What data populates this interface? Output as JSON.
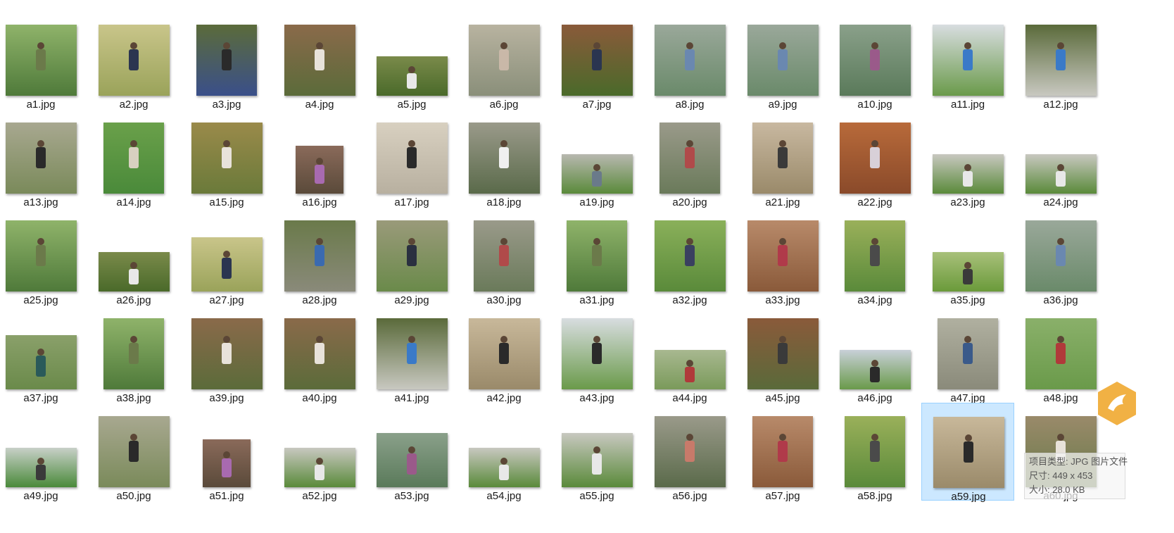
{
  "files": [
    {
      "name": "a1.jpg",
      "colors": [
        "#4f7a3a",
        "#8fb36a"
      ],
      "shape": "wide",
      "shirt": "#6b7a4a"
    },
    {
      "name": "a2.jpg",
      "colors": [
        "#9aa35a",
        "#c9c58a"
      ],
      "shape": "wide",
      "shirt": "#2b3550"
    },
    {
      "name": "a3.jpg",
      "colors": [
        "#3a4f8a",
        "#5b6b3a"
      ],
      "shape": "square",
      "shirt": "#2a2a2a"
    },
    {
      "name": "a4.jpg",
      "colors": [
        "#5b6b3a",
        "#8a6a4a"
      ],
      "shape": "wide",
      "shirt": "#e8e2da"
    },
    {
      "name": "a5.jpg",
      "colors": [
        "#4a6a2a",
        "#7a8a4a"
      ],
      "shape": "short",
      "shirt": "#e8e8e8"
    },
    {
      "name": "a6.jpg",
      "colors": [
        "#8a8f7a",
        "#b8b3a0"
      ],
      "shape": "wide",
      "shirt": "#c9b8a8"
    },
    {
      "name": "a7.jpg",
      "colors": [
        "#4a6a2a",
        "#8a5a3a"
      ],
      "shape": "wide",
      "shirt": "#2b3550"
    },
    {
      "name": "a8.jpg",
      "colors": [
        "#6a8a6a",
        "#9aa89a"
      ],
      "shape": "wide",
      "shirt": "#6a88b0"
    },
    {
      "name": "a9.jpg",
      "colors": [
        "#6a8a6a",
        "#9aa89a"
      ],
      "shape": "wide",
      "shirt": "#6a88b0"
    },
    {
      "name": "a10.jpg",
      "colors": [
        "#5a7a5a",
        "#8aa08a"
      ],
      "shape": "wide",
      "shirt": "#9a5a8a"
    },
    {
      "name": "a11.jpg",
      "colors": [
        "#6a9a4a",
        "#d8dde0"
      ],
      "shape": "wide",
      "shirt": "#3a7ac8"
    },
    {
      "name": "a12.jpg",
      "colors": [
        "#c8c8c0",
        "#5a6a3a"
      ],
      "shape": "wide",
      "shirt": "#3a7ac8"
    },
    {
      "name": "a13.jpg",
      "colors": [
        "#7a8a5a",
        "#a8a890"
      ],
      "shape": "wide",
      "shirt": "#2a2a2a"
    },
    {
      "name": "a14.jpg",
      "colors": [
        "#4a8a3a",
        "#6aa04a"
      ],
      "shape": "square",
      "shirt": "#d8d0c0"
    },
    {
      "name": "a15.jpg",
      "colors": [
        "#6a7a3a",
        "#9a8a4a"
      ],
      "shape": "wide",
      "shirt": "#e8e2da"
    },
    {
      "name": "a16.jpg",
      "colors": [
        "#5a4a3a",
        "#8a6a5a"
      ],
      "shape": "small",
      "shirt": "#a86ab0"
    },
    {
      "name": "a17.jpg",
      "colors": [
        "#b8b0a0",
        "#d8d0c0"
      ],
      "shape": "wide",
      "shirt": "#2a2a2a"
    },
    {
      "name": "a18.jpg",
      "colors": [
        "#5a6a4a",
        "#9a9a8a"
      ],
      "shape": "wide",
      "shirt": "#f0f0f0"
    },
    {
      "name": "a19.jpg",
      "colors": [
        "#5a8a3a",
        "#b8b8b0"
      ],
      "shape": "short",
      "shirt": "#6a7a8a"
    },
    {
      "name": "a20.jpg",
      "colors": [
        "#6a7a5a",
        "#9a9a8a"
      ],
      "shape": "square",
      "shirt": "#b04a4a"
    },
    {
      "name": "a21.jpg",
      "colors": [
        "#9a8a6a",
        "#c8b8a0"
      ],
      "shape": "square",
      "shirt": "#3a3a3a"
    },
    {
      "name": "a22.jpg",
      "colors": [
        "#8a4a2a",
        "#b86a3a"
      ],
      "shape": "wide",
      "shirt": "#d8d0d8"
    },
    {
      "name": "a23.jpg",
      "colors": [
        "#5a8a3a",
        "#c8c8c0"
      ],
      "shape": "short",
      "shirt": "#e8e8e8"
    },
    {
      "name": "a24.jpg",
      "colors": [
        "#5a8a3a",
        "#c8c8c0"
      ],
      "shape": "short",
      "shirt": "#e8e8e8"
    },
    {
      "name": "a25.jpg",
      "colors": [
        "#4f7a3a",
        "#8fb36a"
      ],
      "shape": "wide",
      "shirt": "#6b7a4a"
    },
    {
      "name": "a26.jpg",
      "colors": [
        "#4a6a2a",
        "#7a8a4a"
      ],
      "shape": "short",
      "shirt": "#e8e8e8"
    },
    {
      "name": "a27.jpg",
      "colors": [
        "#9aa35a",
        "#c9c58a"
      ],
      "shape": "short2",
      "shirt": "#2b3550"
    },
    {
      "name": "a28.jpg",
      "colors": [
        "#8a8a7a",
        "#6a7a4a"
      ],
      "shape": "wide",
      "shirt": "#3a6ab0"
    },
    {
      "name": "a29.jpg",
      "colors": [
        "#6a8a4a",
        "#9a9a7a"
      ],
      "shape": "wide",
      "shirt": "#2a3040"
    },
    {
      "name": "a30.jpg",
      "colors": [
        "#6a7a5a",
        "#9a9a8a"
      ],
      "shape": "square",
      "shirt": "#b04a4a"
    },
    {
      "name": "a31.jpg",
      "colors": [
        "#4f7a3a",
        "#8fb36a"
      ],
      "shape": "square",
      "shirt": "#6b7a4a"
    },
    {
      "name": "a32.jpg",
      "colors": [
        "#5a8a3a",
        "#8ab05a"
      ],
      "shape": "wide",
      "shirt": "#3a4060"
    },
    {
      "name": "a33.jpg",
      "colors": [
        "#8a5a3a",
        "#b88a6a"
      ],
      "shape": "wide",
      "shirt": "#b03a4a"
    },
    {
      "name": "a34.jpg",
      "colors": [
        "#5a8a3a",
        "#9ab05a"
      ],
      "shape": "square",
      "shirt": "#4a4a4a"
    },
    {
      "name": "a35.jpg",
      "colors": [
        "#6a9a3a",
        "#a8c07a"
      ],
      "shape": "short",
      "shirt": "#3a3a3a"
    },
    {
      "name": "a36.jpg",
      "colors": [
        "#6a8a6a",
        "#9aa89a"
      ],
      "shape": "wide",
      "shirt": "#6a88b0"
    },
    {
      "name": "a37.jpg",
      "colors": [
        "#6a8a4a",
        "#8aa06a"
      ],
      "shape": "short2",
      "shirt": "#2a5a5a"
    },
    {
      "name": "a38.jpg",
      "colors": [
        "#4f7a3a",
        "#8fb36a"
      ],
      "shape": "square",
      "shirt": "#6b7a4a"
    },
    {
      "name": "a39.jpg",
      "colors": [
        "#5b6b3a",
        "#8a6a4a"
      ],
      "shape": "wide",
      "shirt": "#e8e2da"
    },
    {
      "name": "a40.jpg",
      "colors": [
        "#5b6b3a",
        "#8a6a4a"
      ],
      "shape": "wide",
      "shirt": "#e8e2da"
    },
    {
      "name": "a41.jpg",
      "colors": [
        "#c8c8c0",
        "#5a6a3a"
      ],
      "shape": "wide",
      "shirt": "#3a7ac8"
    },
    {
      "name": "a42.jpg",
      "colors": [
        "#9a8a6a",
        "#c8b89a"
      ],
      "shape": "wide",
      "shirt": "#2a2a2a"
    },
    {
      "name": "a43.jpg",
      "colors": [
        "#6a9a4a",
        "#d8dde0"
      ],
      "shape": "wide",
      "shirt": "#2a2a2a"
    },
    {
      "name": "a44.jpg",
      "colors": [
        "#7a9a5a",
        "#a8b890"
      ],
      "shape": "short",
      "shirt": "#b03a3a"
    },
    {
      "name": "a45.jpg",
      "colors": [
        "#5a6a3a",
        "#8a5a3a"
      ],
      "shape": "wide",
      "shirt": "#3a3a3a"
    },
    {
      "name": "a46.jpg",
      "colors": [
        "#6a9a4a",
        "#c8d0d8"
      ],
      "shape": "short",
      "shirt": "#2a2a2a"
    },
    {
      "name": "a47.jpg",
      "colors": [
        "#8a8a7a",
        "#b0b0a0"
      ],
      "shape": "square",
      "shirt": "#3a5a8a"
    },
    {
      "name": "a48.jpg",
      "colors": [
        "#6a9a4a",
        "#8ab06a"
      ],
      "shape": "wide",
      "shirt": "#b03a3a"
    },
    {
      "name": "a49.jpg",
      "colors": [
        "#4a8a3a",
        "#c8d0c8"
      ],
      "shape": "short",
      "shirt": "#3a3a3a"
    },
    {
      "name": "a50.jpg",
      "colors": [
        "#7a8a5a",
        "#a8a890"
      ],
      "shape": "wide",
      "shirt": "#2a2a2a"
    },
    {
      "name": "a51.jpg",
      "colors": [
        "#5a4a3a",
        "#8a6a5a"
      ],
      "shape": "small",
      "shirt": "#a86ab0"
    },
    {
      "name": "a52.jpg",
      "colors": [
        "#5a8a3a",
        "#c8c8c0"
      ],
      "shape": "short",
      "shirt": "#e8e8e8"
    },
    {
      "name": "a53.jpg",
      "colors": [
        "#5a7a5a",
        "#8aa08a"
      ],
      "shape": "short2",
      "shirt": "#9a5a8a"
    },
    {
      "name": "a54.jpg",
      "colors": [
        "#5a8a3a",
        "#c8c8c0"
      ],
      "shape": "short",
      "shirt": "#e8e8e8"
    },
    {
      "name": "a55.jpg",
      "colors": [
        "#5a8a3a",
        "#c8c8c0"
      ],
      "shape": "short2",
      "shirt": "#e8e8e8"
    },
    {
      "name": "a56.jpg",
      "colors": [
        "#5a6a4a",
        "#9a9a8a"
      ],
      "shape": "wide",
      "shirt": "#c87a6a"
    },
    {
      "name": "a57.jpg",
      "colors": [
        "#8a5a3a",
        "#b88a6a"
      ],
      "shape": "square",
      "shirt": "#b03a4a"
    },
    {
      "name": "a58.jpg",
      "colors": [
        "#5a8a3a",
        "#9ab05a"
      ],
      "shape": "square",
      "shirt": "#4a4a4a"
    },
    {
      "name": "a59.jpg",
      "colors": [
        "#9a8a6a",
        "#c8b89a"
      ],
      "shape": "wide",
      "shirt": "#2a2a2a"
    },
    {
      "name": "a60.jpg",
      "colors": [
        "#6a7a4a",
        "#9a8a6a"
      ],
      "shape": "wide",
      "shirt": "#e8e2da"
    }
  ],
  "selected_index": 58,
  "tooltip": {
    "type_line": "项目类型: JPG 图片文件",
    "dims_line": "尺寸: 449 x 453",
    "size_line": "大小: 28.0 KB"
  },
  "logo": {
    "icon": "bird-logo-icon",
    "color": "#f0a830"
  }
}
